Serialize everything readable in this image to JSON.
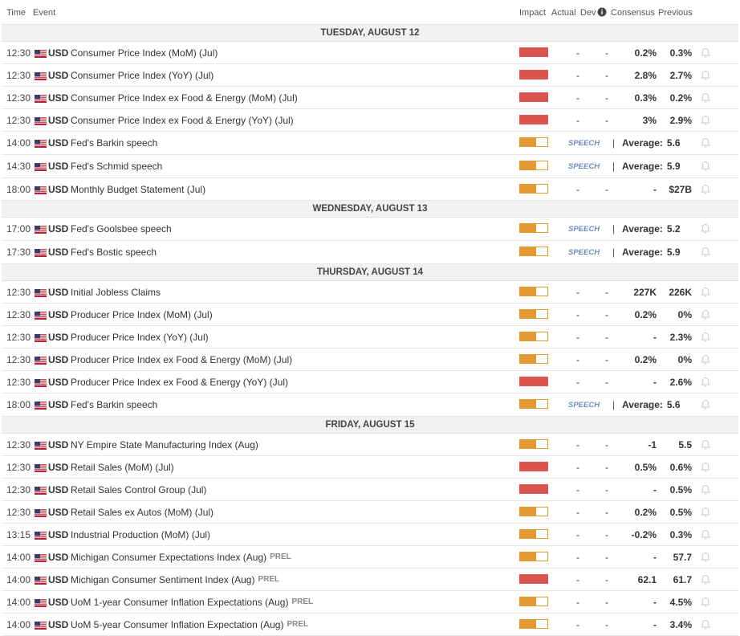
{
  "header": {
    "time": "Time",
    "event": "Event",
    "impact": "Impact",
    "actual": "Actual",
    "dev": "Dev",
    "consensus": "Consensus",
    "previous": "Previous"
  },
  "colors": {
    "high": "#d9534f",
    "medium": "#e39a35",
    "speech": "#6d8ebd",
    "day_bg": "#f1f1f1"
  },
  "days": [
    {
      "label": "TUESDAY, AUGUST 12",
      "events": [
        {
          "time": "12:30",
          "currency": "USD",
          "name": "Consumer Price Index (MoM) (Jul)",
          "impact": "high",
          "actual": "-",
          "dev": "-",
          "consensus": "0.2%",
          "previous": "0.3%"
        },
        {
          "time": "12:30",
          "currency": "USD",
          "name": "Consumer Price Index (YoY) (Jul)",
          "impact": "high",
          "actual": "-",
          "dev": "-",
          "consensus": "2.8%",
          "previous": "2.7%"
        },
        {
          "time": "12:30",
          "currency": "USD",
          "name": "Consumer Price Index ex Food & Energy (MoM) (Jul)",
          "impact": "high",
          "actual": "-",
          "dev": "-",
          "consensus": "0.3%",
          "previous": "0.2%"
        },
        {
          "time": "12:30",
          "currency": "USD",
          "name": "Consumer Price Index ex Food & Energy (YoY) (Jul)",
          "impact": "high",
          "actual": "-",
          "dev": "-",
          "consensus": "3%",
          "previous": "2.9%"
        },
        {
          "time": "14:00",
          "currency": "USD",
          "name": "Fed's Barkin speech",
          "impact": "medium",
          "speech": "SPEECH",
          "bar": "|",
          "average_label": "Average:",
          "average": "5.6"
        },
        {
          "time": "14:30",
          "currency": "USD",
          "name": "Fed's Schmid speech",
          "impact": "medium",
          "speech": "SPEECH",
          "bar": "|",
          "average_label": "Average:",
          "average": "5.9"
        },
        {
          "time": "18:00",
          "currency": "USD",
          "name": "Monthly Budget Statement (Jul)",
          "impact": "medium",
          "actual": "-",
          "dev": "-",
          "consensus": "-",
          "previous": "$27B"
        }
      ]
    },
    {
      "label": "WEDNESDAY, AUGUST 13",
      "events": [
        {
          "time": "17:00",
          "currency": "USD",
          "name": "Fed's Goolsbee speech",
          "impact": "medium",
          "speech": "SPEECH",
          "bar": "|",
          "average_label": "Average:",
          "average": "5.2"
        },
        {
          "time": "17:30",
          "currency": "USD",
          "name": "Fed's Bostic speech",
          "impact": "medium",
          "speech": "SPEECH",
          "bar": "|",
          "average_label": "Average:",
          "average": "5.9"
        }
      ]
    },
    {
      "label": "THURSDAY, AUGUST 14",
      "events": [
        {
          "time": "12:30",
          "currency": "USD",
          "name": "Initial Jobless Claims",
          "impact": "medium",
          "actual": "-",
          "dev": "-",
          "consensus": "227K",
          "previous": "226K"
        },
        {
          "time": "12:30",
          "currency": "USD",
          "name": "Producer Price Index (MoM) (Jul)",
          "impact": "medium",
          "actual": "-",
          "dev": "-",
          "consensus": "0.2%",
          "previous": "0%"
        },
        {
          "time": "12:30",
          "currency": "USD",
          "name": "Producer Price Index (YoY) (Jul)",
          "impact": "medium",
          "actual": "-",
          "dev": "-",
          "consensus": "-",
          "previous": "2.3%"
        },
        {
          "time": "12:30",
          "currency": "USD",
          "name": "Producer Price Index ex Food & Energy (MoM) (Jul)",
          "impact": "medium",
          "actual": "-",
          "dev": "-",
          "consensus": "0.2%",
          "previous": "0%"
        },
        {
          "time": "12:30",
          "currency": "USD",
          "name": "Producer Price Index ex Food & Energy (YoY) (Jul)",
          "impact": "high",
          "actual": "-",
          "dev": "-",
          "consensus": "-",
          "previous": "2.6%"
        },
        {
          "time": "18:00",
          "currency": "USD",
          "name": "Fed's Barkin speech",
          "impact": "medium",
          "speech": "SPEECH",
          "bar": "|",
          "average_label": "Average:",
          "average": "5.6"
        }
      ]
    },
    {
      "label": "FRIDAY, AUGUST 15",
      "events": [
        {
          "time": "12:30",
          "currency": "USD",
          "name": "NY Empire State Manufacturing Index (Aug)",
          "impact": "medium",
          "actual": "-",
          "dev": "-",
          "consensus": "-1",
          "previous": "5.5"
        },
        {
          "time": "12:30",
          "currency": "USD",
          "name": "Retail Sales (MoM) (Jul)",
          "impact": "high",
          "actual": "-",
          "dev": "-",
          "consensus": "0.5%",
          "previous": "0.6%"
        },
        {
          "time": "12:30",
          "currency": "USD",
          "name": "Retail Sales Control Group (Jul)",
          "impact": "high",
          "actual": "-",
          "dev": "-",
          "consensus": "-",
          "previous": "0.5%"
        },
        {
          "time": "12:30",
          "currency": "USD",
          "name": "Retail Sales ex Autos (MoM) (Jul)",
          "impact": "medium",
          "actual": "-",
          "dev": "-",
          "consensus": "0.2%",
          "previous": "0.5%"
        },
        {
          "time": "13:15",
          "currency": "USD",
          "name": "Industrial Production (MoM) (Jul)",
          "impact": "medium",
          "actual": "-",
          "dev": "-",
          "consensus": "-0.2%",
          "previous": "0.3%"
        },
        {
          "time": "14:00",
          "currency": "USD",
          "name": "Michigan Consumer Expectations Index (Aug)",
          "tag": "PREL",
          "impact": "medium",
          "actual": "-",
          "dev": "-",
          "consensus": "-",
          "previous": "57.7"
        },
        {
          "time": "14:00",
          "currency": "USD",
          "name": "Michigan Consumer Sentiment Index (Aug)",
          "tag": "PREL",
          "impact": "high",
          "actual": "-",
          "dev": "-",
          "consensus": "62.1",
          "previous": "61.7"
        },
        {
          "time": "14:00",
          "currency": "USD",
          "name": "UoM 1-year Consumer Inflation Expectations (Aug)",
          "tag": "PREL",
          "impact": "medium",
          "actual": "-",
          "dev": "-",
          "consensus": "-",
          "previous": "4.5%"
        },
        {
          "time": "14:00",
          "currency": "USD",
          "name": "UoM 5-year Consumer Inflation Expectation (Aug)",
          "tag": "PREL",
          "impact": "medium",
          "actual": "-",
          "dev": "-",
          "consensus": "-",
          "previous": "3.4%"
        }
      ]
    }
  ]
}
